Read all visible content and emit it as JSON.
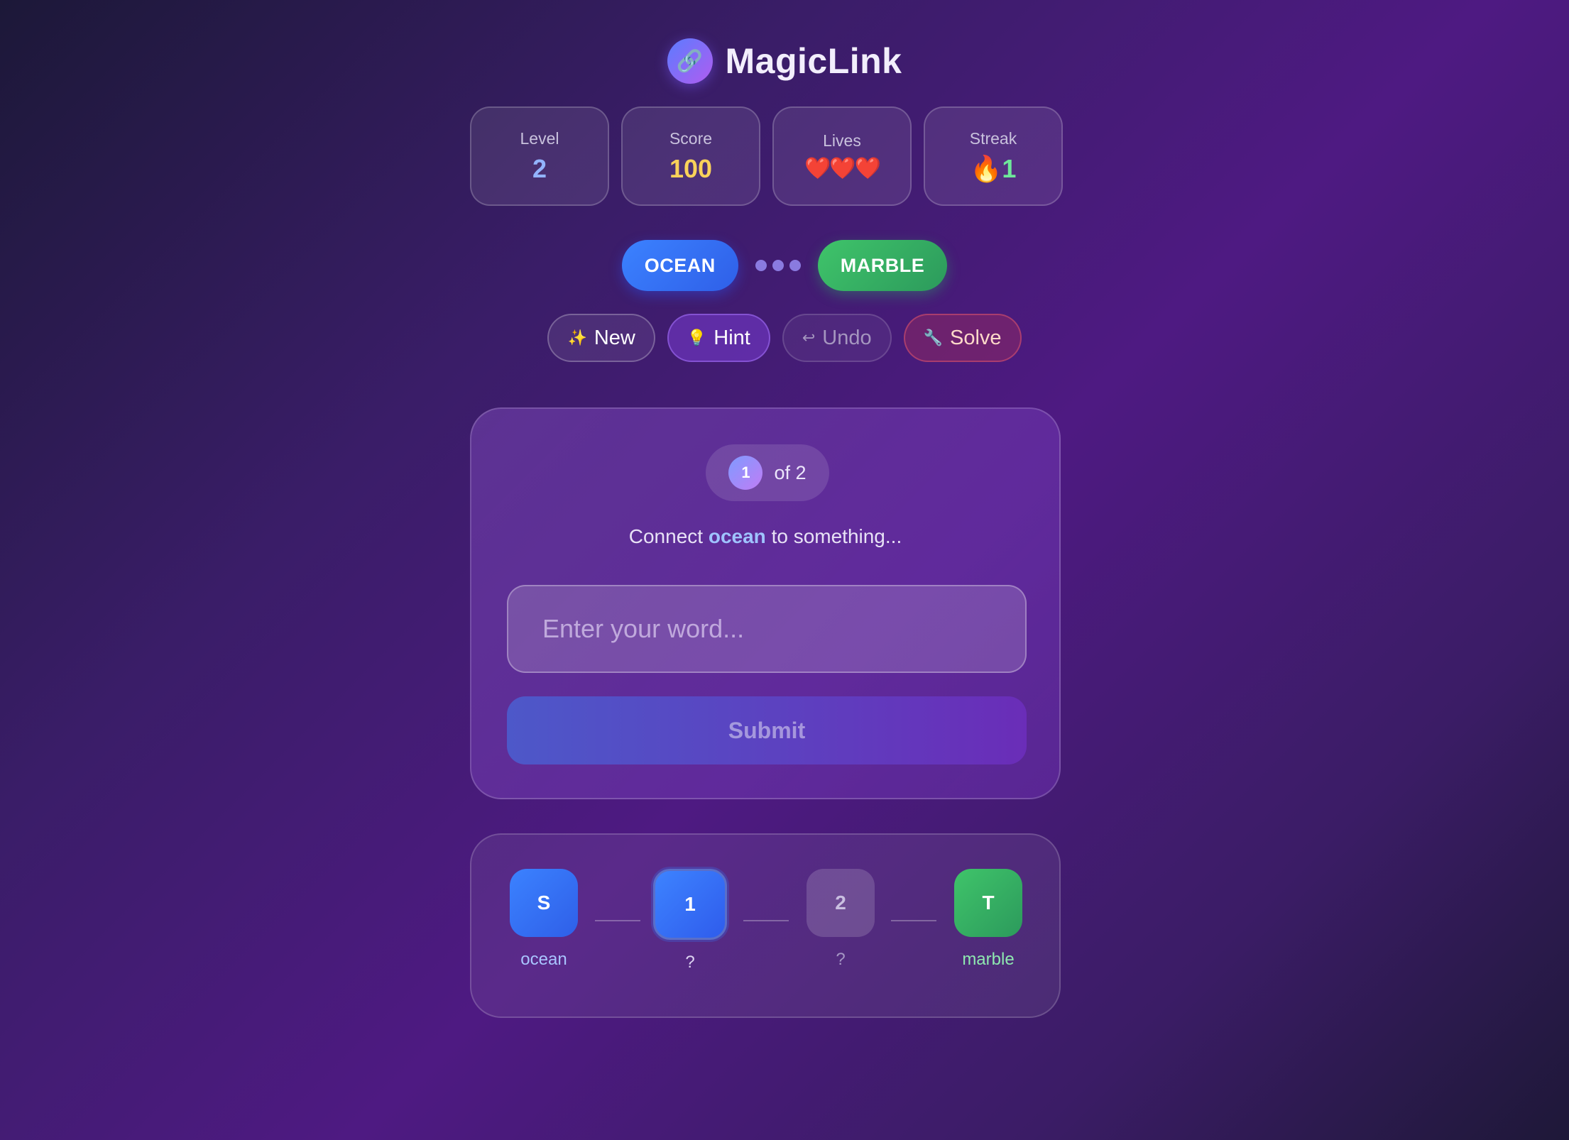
{
  "app": {
    "title": "MagicLink",
    "logo_icon": "🔗"
  },
  "stats": {
    "level": {
      "label": "Level",
      "value": "2"
    },
    "score": {
      "label": "Score",
      "value": "100"
    },
    "lives": {
      "label": "Lives",
      "value": "❤️❤️❤️"
    },
    "streak": {
      "label": "Streak",
      "value": "🔥1"
    }
  },
  "endpoints": {
    "start": "OCEAN",
    "target": "MARBLE"
  },
  "actions": {
    "new": {
      "icon": "✨",
      "label": "New"
    },
    "hint": {
      "icon": "💡",
      "label": "Hint"
    },
    "undo": {
      "icon": "↩",
      "label": "Undo"
    },
    "solve": {
      "icon": "🔧",
      "label": "Solve"
    }
  },
  "puzzle": {
    "step_current": "1",
    "step_total_text": "of 2",
    "prompt_prefix": "Connect",
    "prompt_word": "ocean",
    "prompt_suffix": "to something...",
    "input_placeholder": "Enter your word...",
    "input_value": "",
    "submit_label": "Submit"
  },
  "chain": [
    {
      "badge": "S",
      "label": "ocean"
    },
    {
      "badge": "1",
      "label": "?"
    },
    {
      "badge": "2",
      "label": "?"
    },
    {
      "badge": "T",
      "label": "marble"
    }
  ],
  "colors": {
    "start": "#3b82ff",
    "target": "#3fc46a",
    "score": "#f9d25a",
    "level": "#93b4ff"
  }
}
